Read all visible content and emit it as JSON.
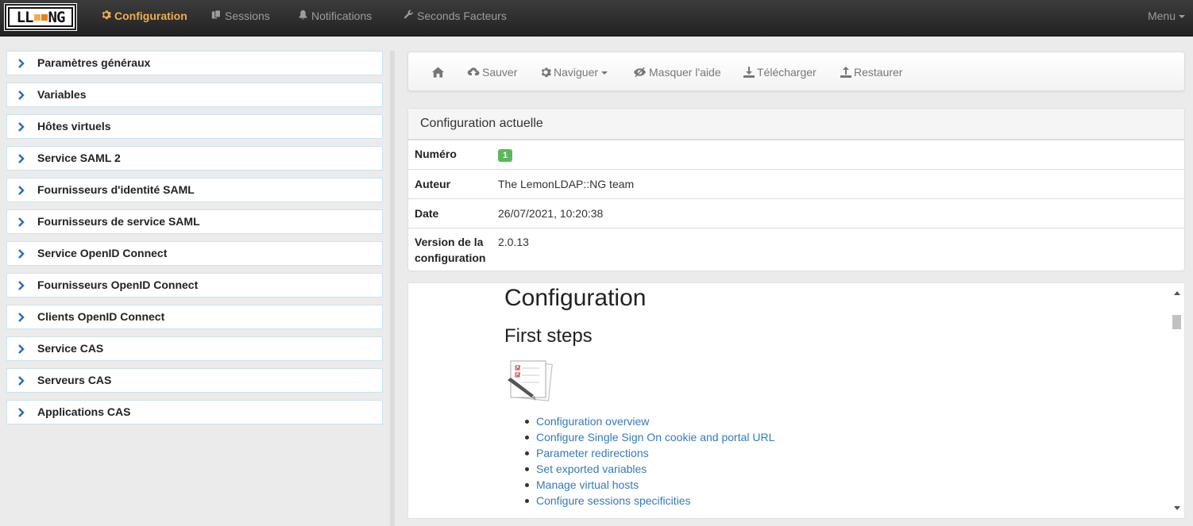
{
  "navbar": {
    "logo": "LL::NG",
    "items": [
      {
        "label": "Configuration",
        "icon": "gear-icon"
      },
      {
        "label": "Sessions",
        "icon": "copy-icon"
      },
      {
        "label": "Notifications",
        "icon": "bell-icon"
      },
      {
        "label": "Seconds Facteurs",
        "icon": "wrench-icon"
      }
    ],
    "menu_label": "Menu"
  },
  "sidebar": {
    "items": [
      {
        "label": "Paramètres généraux"
      },
      {
        "label": "Variables"
      },
      {
        "label": "Hôtes virtuels"
      },
      {
        "label": "Service SAML 2"
      },
      {
        "label": "Fournisseurs d'identité SAML"
      },
      {
        "label": "Fournisseurs de service SAML"
      },
      {
        "label": "Service OpenID Connect"
      },
      {
        "label": "Fournisseurs OpenID Connect"
      },
      {
        "label": "Clients OpenID Connect"
      },
      {
        "label": "Service CAS"
      },
      {
        "label": "Serveurs CAS"
      },
      {
        "label": "Applications CAS"
      }
    ]
  },
  "toolbar": {
    "home_icon": "home-icon",
    "save_label": "Sauver",
    "navigate_label": "Naviguer",
    "hide_help_label": "Masquer l'aide",
    "download_label": "Télécharger",
    "restore_label": "Restaurer"
  },
  "config_panel": {
    "title": "Configuration actuelle",
    "number_label": "Numéro",
    "number_value": "1",
    "author_label": "Auteur",
    "author_value": "The LemonLDAP::NG team",
    "date_label": "Date",
    "date_value": "26/07/2021, 10:20:38",
    "version_label_1": "Version de la",
    "version_label_2": "configuration",
    "version_value": "2.0.13"
  },
  "help": {
    "title": "Configuration",
    "subtitle": "First steps",
    "links": [
      "Configuration overview",
      "Configure Single Sign On cookie and portal URL",
      "Parameter redirections",
      "Set exported variables",
      "Manage virtual hosts",
      "Configure sessions specificities"
    ]
  },
  "colors": {
    "accent": "#f0ad4e",
    "link": "#337ab7",
    "badge": "#5cb85c",
    "chevron": "#2a6cb8"
  }
}
